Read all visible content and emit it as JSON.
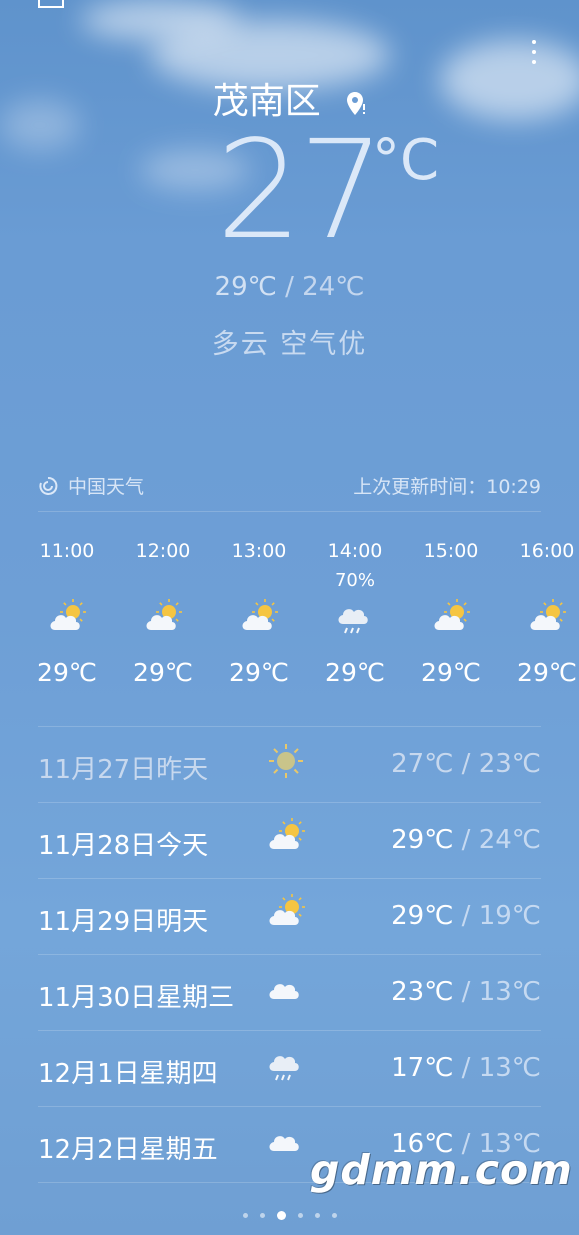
{
  "header": {
    "city": "茂南区",
    "current_temp": "27",
    "unit": "°C",
    "high": "29℃",
    "separator": " / ",
    "low": "24℃",
    "condition": "多云  空气优"
  },
  "source": {
    "provider": "中国天气",
    "updated": "上次更新时间：10:29"
  },
  "hourly": [
    {
      "time": "11:00",
      "precip": "",
      "icon": "partly-cloudy-sun-icon",
      "temp": "29℃"
    },
    {
      "time": "12:00",
      "precip": "",
      "icon": "partly-cloudy-sun-icon",
      "temp": "29℃"
    },
    {
      "time": "13:00",
      "precip": "",
      "icon": "partly-cloudy-sun-icon",
      "temp": "29℃"
    },
    {
      "time": "14:00",
      "precip": "70%",
      "icon": "rain-cloud-icon",
      "temp": "29℃"
    },
    {
      "time": "15:00",
      "precip": "",
      "icon": "partly-cloudy-sun-icon",
      "temp": "29℃"
    },
    {
      "time": "16:00",
      "precip": "",
      "icon": "partly-cloudy-sun-icon",
      "temp": "29℃"
    }
  ],
  "daily": [
    {
      "date": "11月27日昨天",
      "icon": "sun-icon",
      "high": "27℃",
      "low": "23℃"
    },
    {
      "date": "11月28日今天",
      "icon": "partly-cloudy-sun-icon",
      "high": "29℃",
      "low": "24℃"
    },
    {
      "date": "11月29日明天",
      "icon": "partly-cloudy-sun-icon",
      "high": "29℃",
      "low": "19℃"
    },
    {
      "date": "11月30日星期三",
      "icon": "cloud-icon",
      "high": "23℃",
      "low": "13℃"
    },
    {
      "date": "12月1日星期四",
      "icon": "rain-cloud-icon",
      "high": "17℃",
      "low": "13℃"
    },
    {
      "date": "12月2日星期五",
      "icon": "cloud-icon",
      "high": "16℃",
      "low": "13℃"
    }
  ],
  "watermark": "gdmm.com",
  "page_indicator": {
    "count": 6,
    "active": 2
  }
}
